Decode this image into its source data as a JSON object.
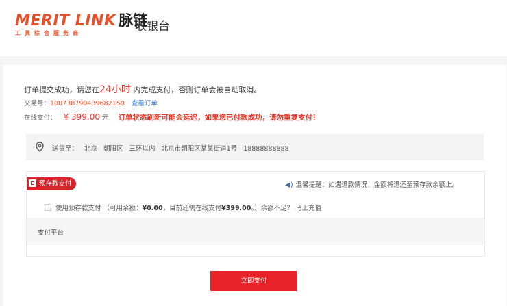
{
  "header": {
    "logo_en": "MERIT LINK",
    "logo_cn": "脉链",
    "logo_sub": "工具综合服务商",
    "page_title": "收银台"
  },
  "order": {
    "msg_before": "订单提交成功，请您在",
    "msg_highlight": "24小时",
    "msg_after": "内完成支付，否则订单会被自动取消。",
    "trade_label": "交易号：",
    "trade_no": "100738790439682150",
    "view_order": "查看订单",
    "pay_label": "在线支付：",
    "amount": "¥ 399.00",
    "unit": "元",
    "warning": "订单状态刷新可能会延迟，如果您已付款成功，请勿重复支付！"
  },
  "address": {
    "icon": "location-pin-icon",
    "text": "送货至：  北京  朝阳区  三环以内    北京市朝阳区某某街道1号  18888888888"
  },
  "payment": {
    "tag_label": "预存款支付",
    "tip": "温馨提醒：如遇退款情况，金额将退还至预存款余额上。",
    "balance_prefix": "使用预存款支付 （可用余额：",
    "balance_amount": "¥0.00",
    "balance_mid": "，目前还需在线支付",
    "need_amount": "¥399.00",
    "balance_suffix": "。）余额不足？ 马上充值",
    "platform_label": "支付平台"
  },
  "submit": {
    "label": "立即支付"
  },
  "colors": {
    "accent": "#e8232a",
    "brand": "#e8502a",
    "link": "#2b6ecf"
  }
}
